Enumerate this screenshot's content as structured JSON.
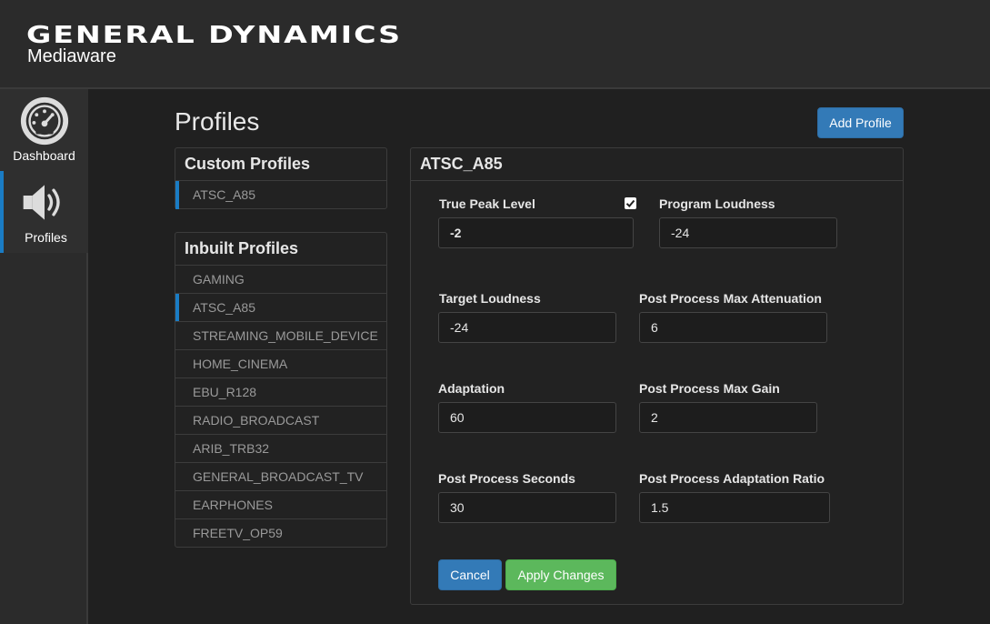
{
  "brand": {
    "name": "GENERAL DYNAMICS",
    "product": "Mediaware"
  },
  "nav": [
    {
      "label": "Dashboard",
      "icon": "dashboard-gauge-icon"
    },
    {
      "label": "Profiles",
      "icon": "speaker-icon"
    }
  ],
  "page": {
    "title": "Profiles",
    "add_button": "Add Profile"
  },
  "custom_profiles": {
    "heading": "Custom Profiles",
    "items": [
      "ATSC_A85"
    ]
  },
  "inbuilt_profiles": {
    "heading": "Inbuilt Profiles",
    "items": [
      "GAMING",
      "ATSC_A85",
      "STREAMING_MOBILE_DEVICE",
      "HOME_CINEMA",
      "EBU_R128",
      "RADIO_BROADCAST",
      "ARIB_TRB32",
      "GENERAL_BROADCAST_TV",
      "EARPHONES",
      "FREETV_OP59"
    ],
    "selected": "ATSC_A85"
  },
  "detail": {
    "title": "ATSC_A85",
    "true_peak": {
      "label": "True Peak Level",
      "value": "-2",
      "enabled": true
    },
    "program_loudness": {
      "label": "Program Loudness",
      "value": "-24"
    },
    "target_loudness": {
      "label": "Target Loudness",
      "value": "-24"
    },
    "max_attenuation": {
      "label": "Post Process Max Attenuation",
      "value": "6"
    },
    "adaptation": {
      "label": "Adaptation",
      "value": "60"
    },
    "max_gain": {
      "label": "Post Process Max Gain",
      "value": "2"
    },
    "seconds": {
      "label": "Post Process Seconds",
      "value": "30"
    },
    "adaptation_ratio": {
      "label": "Post Process Adaptation Ratio",
      "value": "1.5"
    },
    "cancel_button": "Cancel",
    "apply_button": "Apply Changes"
  },
  "colors": {
    "accent": "#1a7cc4",
    "primary": "#337ab7",
    "success": "#5cb85c",
    "background": "#202020"
  }
}
